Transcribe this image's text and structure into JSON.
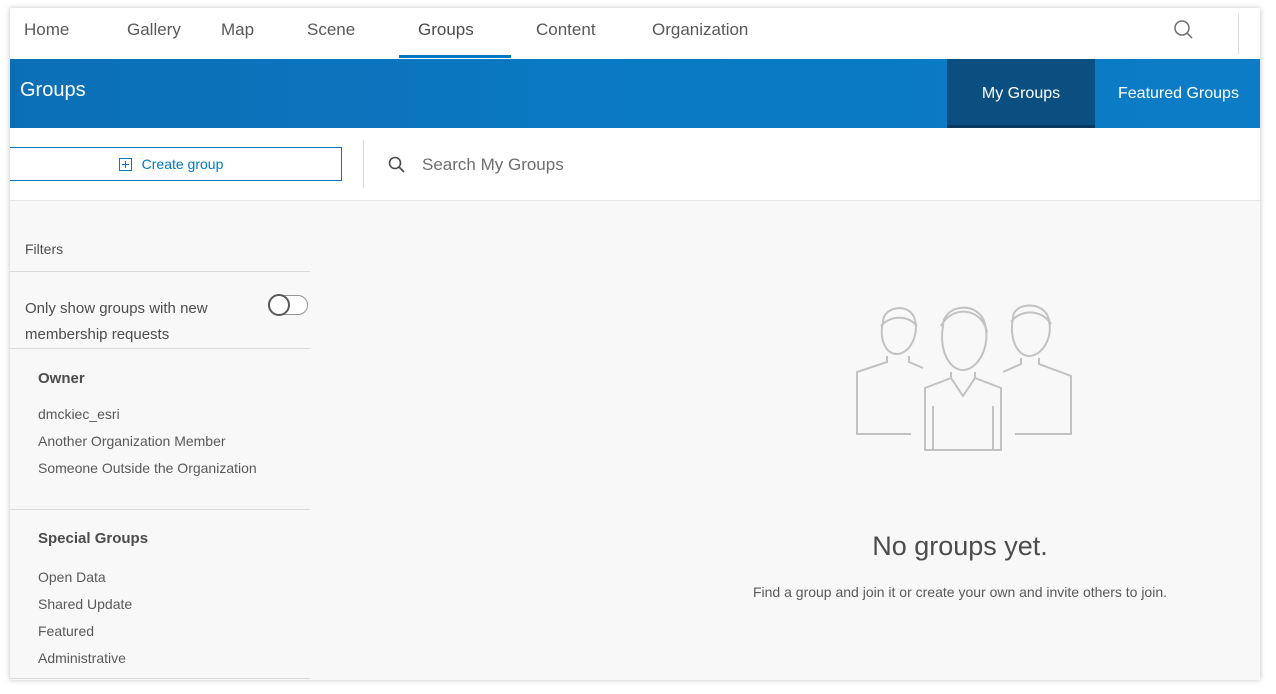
{
  "topnav": {
    "tabs": [
      {
        "label": "Home"
      },
      {
        "label": "Gallery"
      },
      {
        "label": "Map"
      },
      {
        "label": "Scene"
      },
      {
        "label": "Groups"
      },
      {
        "label": "Content"
      },
      {
        "label": "Organization"
      }
    ],
    "active_tab": "Groups"
  },
  "banner": {
    "title": "Groups",
    "tabs": [
      {
        "label": "My Groups"
      },
      {
        "label": "Featured Groups"
      }
    ],
    "active_tab": "My Groups"
  },
  "toolbar": {
    "create_label": "Create group",
    "search_placeholder": "Search My Groups"
  },
  "sidebar": {
    "filters_heading": "Filters",
    "toggle_label": "Only show groups with new membership requests",
    "toggle_on": false,
    "sections": [
      {
        "title": "Owner",
        "items": [
          "dmckiec_esri",
          "Another Organization Member",
          "Someone Outside the Organization"
        ]
      },
      {
        "title": "Special Groups",
        "items": [
          "Open Data",
          "Shared Update",
          "Featured",
          "Administrative"
        ]
      }
    ]
  },
  "empty_state": {
    "icon": "people-group-icon",
    "title": "No groups yet.",
    "message": "Find a group and join it or create your own and invite others to join."
  },
  "colors": {
    "accent": "#0079c1",
    "banner": "#0a79c4",
    "banner_active": "#0b4f80"
  }
}
